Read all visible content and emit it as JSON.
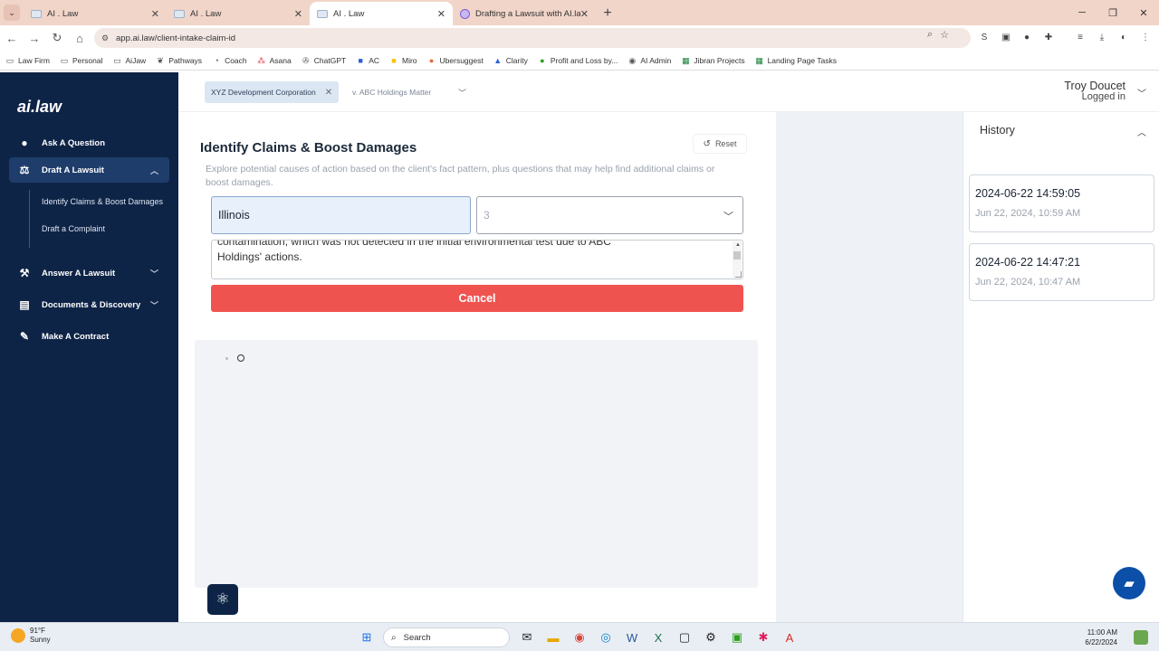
{
  "browser": {
    "tabs": [
      {
        "title": "AI . Law",
        "active": false
      },
      {
        "title": "AI . Law",
        "active": false
      },
      {
        "title": "AI . Law",
        "active": true
      },
      {
        "title": "Drafting a Lawsuit with AI.law",
        "active": false
      }
    ],
    "url": "app.ai.law/client-intake-claim-id",
    "bookmarks": [
      "Law Firm",
      "Personal",
      "AiJaw",
      "Pathways",
      "Coach",
      "Asana",
      "ChatGPT",
      "AC",
      "Miro",
      "Ubersuggest",
      "Clarity",
      "Profit and Loss by...",
      "AI Admin",
      "Jibran Projects",
      "Landing Page Tasks"
    ]
  },
  "sidebar": {
    "logo": "ai.law",
    "items": [
      {
        "label": "Ask A Question",
        "icon": "search-icon"
      },
      {
        "label": "Draft A Lawsuit",
        "icon": "scale-icon"
      },
      {
        "label": "Answer A Lawsuit",
        "icon": "gavel-icon"
      },
      {
        "label": "Documents & Discovery",
        "icon": "document-icon"
      },
      {
        "label": "Make A Contract",
        "icon": "pen-icon"
      }
    ],
    "subitems": [
      "Identify Claims & Boost Damages",
      "Draft a Complaint"
    ]
  },
  "topbar": {
    "client": "XYZ Development Corporation",
    "matter": "v. ABC Holdings Matter",
    "user_name": "Troy Doucet",
    "user_status": "Logged in"
  },
  "main": {
    "title": "Identify Claims & Boost Damages",
    "reset_label": "Reset",
    "description": "Explore potential causes of action based on the client's fact pattern, plus questions that may help find additional claims or boost damages.",
    "state_value": "Illinois",
    "number_value": "3",
    "facts_line1": "contamination, which was not detected in the initial environmental test due to ABC",
    "facts_line2": "Holdings' actions.",
    "cancel_label": "Cancel"
  },
  "history": {
    "title": "History",
    "entries": [
      {
        "title": "2024-06-22 14:59:05",
        "date": "Jun 22, 2024, 10:59 AM"
      },
      {
        "title": "2024-06-22 14:47:21",
        "date": "Jun 22, 2024, 10:47 AM"
      }
    ]
  },
  "taskbar": {
    "temp": "91°F",
    "condition": "Sunny",
    "search_label": "Search",
    "time": "11:00 AM",
    "date": "6/22/2024"
  },
  "colors": {
    "sidebar_bg": "#0e2447",
    "cancel_bg": "#ef5350",
    "accent_blue": "#0b4fa8"
  }
}
